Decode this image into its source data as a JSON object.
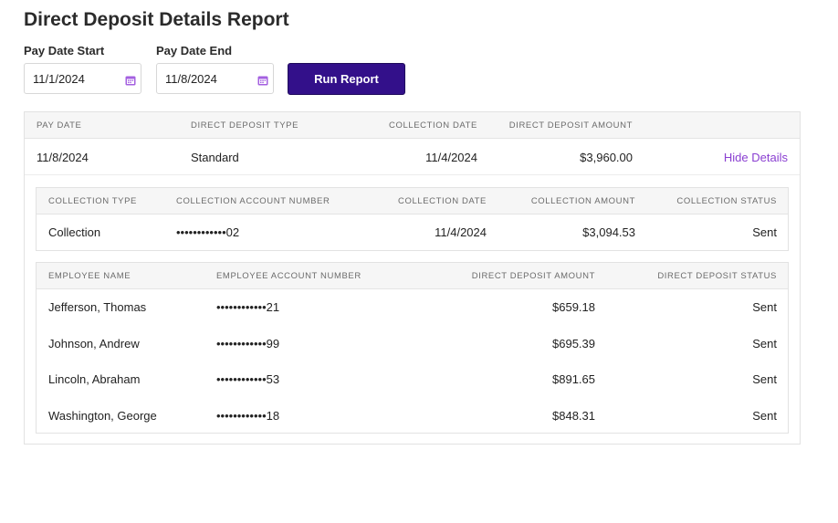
{
  "page": {
    "title": "Direct Deposit Details Report"
  },
  "filters": {
    "start_label": "Pay Date Start",
    "start_value": "11/1/2024",
    "end_label": "Pay Date End",
    "end_value": "11/8/2024",
    "run_label": "Run Report",
    "icon": "calendar-icon"
  },
  "main_table": {
    "headers": [
      "PAY DATE",
      "DIRECT DEPOSIT TYPE",
      "COLLECTION DATE",
      "DIRECT DEPOSIT AMOUNT"
    ],
    "row": {
      "pay_date": "11/8/2024",
      "type": "Standard",
      "collection_date": "11/4/2024",
      "amount": "$3,960.00",
      "action": "Hide Details"
    }
  },
  "collection_table": {
    "headers": [
      "COLLECTION TYPE",
      "COLLECTION ACCOUNT NUMBER",
      "COLLECTION DATE",
      "COLLECTION AMOUNT",
      "COLLECTION STATUS"
    ],
    "row": {
      "type": "Collection",
      "account": "••••••••••••02",
      "date": "11/4/2024",
      "amount": "$3,094.53",
      "status": "Sent"
    }
  },
  "employee_table": {
    "headers": [
      "EMPLOYEE NAME",
      "EMPLOYEE ACCOUNT NUMBER",
      "DIRECT DEPOSIT AMOUNT",
      "DIRECT DEPOSIT STATUS"
    ],
    "rows": [
      {
        "name": "Jefferson, Thomas",
        "account": "••••••••••••21",
        "amount": "$659.18",
        "status": "Sent"
      },
      {
        "name": "Johnson, Andrew",
        "account": "••••••••••••99",
        "amount": "$695.39",
        "status": "Sent"
      },
      {
        "name": "Lincoln, Abraham",
        "account": "••••••••••••53",
        "amount": "$891.65",
        "status": "Sent"
      },
      {
        "name": "Washington, George",
        "account": "••••••••••••18",
        "amount": "$848.31",
        "status": "Sent"
      }
    ]
  },
  "colors": {
    "accent": "#33108a",
    "link": "#8a3fd1"
  }
}
